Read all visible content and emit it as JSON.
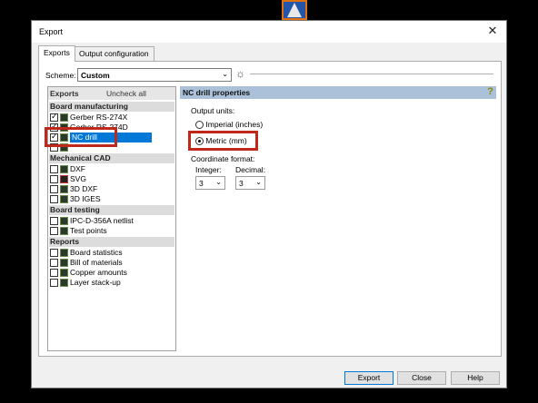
{
  "window": {
    "title": "Export",
    "close_glyph": "✕"
  },
  "tabs": [
    {
      "label": "Exports",
      "active": true
    },
    {
      "label": "Output configuration",
      "active": false
    }
  ],
  "scheme": {
    "label": "Scheme:",
    "value": "Custom",
    "gear_icon": "gear-icon"
  },
  "list": {
    "header": "Exports",
    "uncheck_all": "Uncheck all",
    "groups": [
      {
        "label": "Board manufacturing"
      },
      {
        "label": "Mechanical CAD"
      },
      {
        "label": "Board testing"
      },
      {
        "label": "Reports"
      }
    ],
    "items": [
      {
        "label": "Gerber RS-274X",
        "checked": true
      },
      {
        "label": "Gerber RS-274D",
        "checked": true
      },
      {
        "label": "NC drill",
        "checked": true,
        "selected": true
      },
      {
        "label": "",
        "checked": false
      },
      {
        "label": "DXF",
        "checked": false
      },
      {
        "label": "SVG",
        "checked": false
      },
      {
        "label": "3D DXF",
        "checked": false
      },
      {
        "label": "3D IGES",
        "checked": false
      },
      {
        "label": "IPC-D-356A netlist",
        "checked": false
      },
      {
        "label": "Test points",
        "checked": false
      },
      {
        "label": "Board statistics",
        "checked": false
      },
      {
        "label": "Bill of materials",
        "checked": false
      },
      {
        "label": "Copper amounts",
        "checked": false
      },
      {
        "label": "Layer stack-up",
        "checked": false
      }
    ]
  },
  "props": {
    "title": "NC drill properties",
    "help_icon": "?",
    "output_units_label": "Output units:",
    "units": [
      {
        "label": "Imperial (inches)",
        "selected": false
      },
      {
        "label": "Metric (mm)",
        "selected": true
      }
    ],
    "coordinate_format_label": "Coordinate format:",
    "integer_label": "Integer:",
    "decimal_label": "Decimal:",
    "integer_value": "3",
    "decimal_value": "3"
  },
  "buttons": {
    "export": "Export",
    "close": "Close",
    "help": "Help"
  },
  "colors": {
    "highlight": "#c0281c",
    "selection": "#0078d7",
    "props_header": "#aac1d9"
  }
}
